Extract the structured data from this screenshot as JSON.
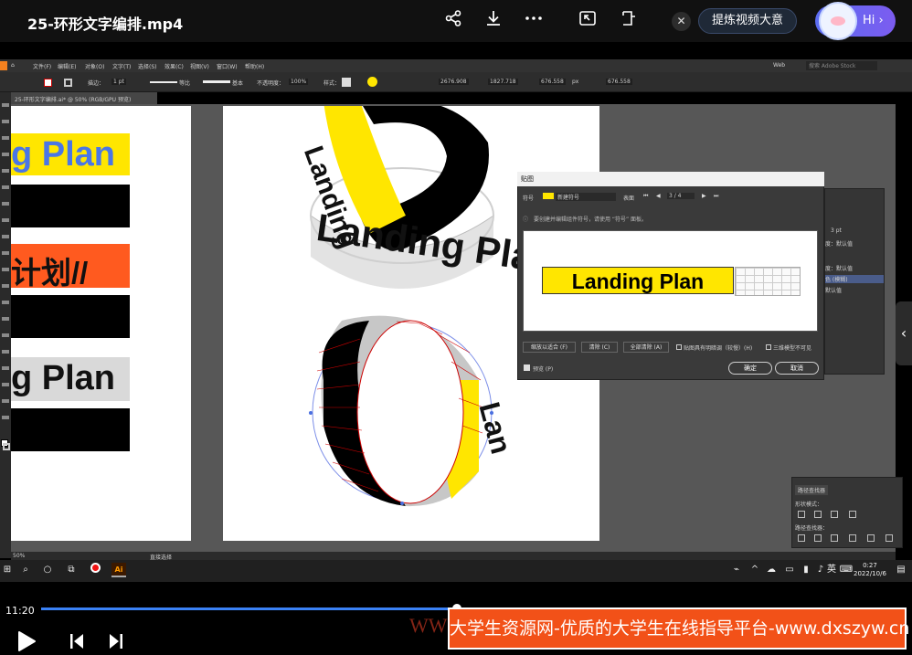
{
  "player": {
    "title": "25-环形文字编排.mp4",
    "summary_label": "提炼视频大意",
    "hi_label": "Hi ›",
    "current_time": "11:20",
    "progress": 0.48,
    "icons": [
      "share-icon",
      "download-icon",
      "more-icon",
      "picture-in-picture-icon",
      "mini-window-icon",
      "close-icon",
      "play-icon",
      "previous-icon",
      "next-icon",
      "chevron-left-icon"
    ]
  },
  "illustrator": {
    "menu": [
      "文件(F)",
      "编辑(E)",
      "对象(O)",
      "文字(T)",
      "选择(S)",
      "效果(C)",
      "视图(V)",
      "窗口(W)",
      "帮助(H)"
    ],
    "workspace": "Web",
    "search_placeholder": "搜索 Adobe Stock",
    "options": {
      "stroke_label": "描边：",
      "stroke_value": "1 pt",
      "profile1": "等比",
      "profile2": "基本",
      "opacity_label": "不透明度：",
      "opacity_value": "100%",
      "style_label": "样式：",
      "x_value": "2676.908",
      "y_value": "1827.718",
      "w_value": "676.558",
      "h_value": "676.558",
      "unit": "px"
    },
    "doc_tab": "25-环形文字编排.ai* @ 50% (RGB/GPU 预览)",
    "zoom": "50%",
    "status_text": "直接选择",
    "artboard_strips": [
      "g Plan",
      "计划//",
      "g Plan"
    ],
    "ring_texts": {
      "top_ring": "Landing",
      "bottom_ring": "Landing Plan",
      "lower_ring": "Lan"
    },
    "dialog": {
      "title": "贴图",
      "symbol_label": "符号",
      "symbol_value": "新建符号",
      "surface_label": "表面",
      "surface_value": "3 / 4",
      "info": "要创建并编辑组件符号，请使用 “符号” 面板。",
      "preview_text": "Landing Plan",
      "btn_fit": "缩放以适合 (F)",
      "btn_clear": "清除 (C)",
      "btn_clear_all": "全部清除 (A)",
      "check_shade": "贴图具有明暗调（较慢）(H)",
      "check_hide": "三维模型不可见",
      "preview_check": "预览 (P)",
      "ok": "确定",
      "cancel": "取消"
    },
    "layers_panel": [
      "3 pt",
      "度：默认值",
      "度：默认值",
      "色 (模糊)",
      "默认值"
    ],
    "pathfinder": {
      "title": "路径查找器",
      "shape_modes": "形状模式：",
      "pathfinders": "路径查找器："
    }
  },
  "taskbar": {
    "time": "0:27",
    "date": "2022/10/6",
    "ime": "英",
    "app_badge": "Ai"
  },
  "watermark": {
    "text": "大学生资源网-优质的大学生在线指导平台-www.dxszyw.cn",
    "ghost": "WW"
  },
  "colors": {
    "yellow": "#ffe600",
    "orange": "#ff5a1f",
    "accent": "#3b82f6"
  }
}
